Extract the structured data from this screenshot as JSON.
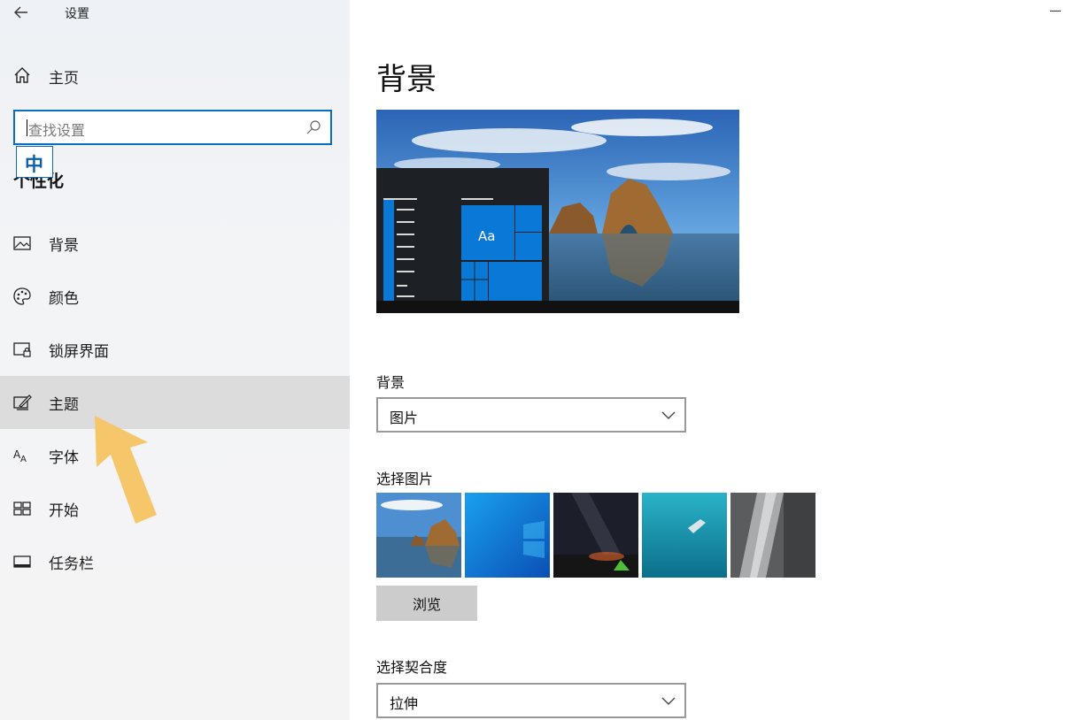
{
  "app": {
    "title": "设置"
  },
  "sidebar": {
    "home_label": "主页",
    "search": {
      "placeholder": "查找设置"
    },
    "ime_indicator": "中",
    "section_header": "个性化",
    "items": [
      {
        "label": "背景",
        "icon": "picture-icon"
      },
      {
        "label": "颜色",
        "icon": "palette-icon"
      },
      {
        "label": "锁屏界面",
        "icon": "lock-screen-icon"
      },
      {
        "label": "主题",
        "icon": "theme-brush-icon",
        "active": true
      },
      {
        "label": "字体",
        "icon": "font-icon"
      },
      {
        "label": "开始",
        "icon": "start-tiles-icon"
      },
      {
        "label": "任务栏",
        "icon": "taskbar-icon"
      }
    ]
  },
  "main": {
    "title": "背景",
    "preview": {
      "tile_text": "Aa"
    },
    "background": {
      "label": "背景",
      "value": "图片"
    },
    "choose_picture": {
      "label": "选择图片",
      "thumbnails": [
        "beach-rock",
        "windows-blue",
        "night-sky-tent",
        "underwater-swimmer",
        "rock-cliff"
      ]
    },
    "browse_label": "浏览",
    "fit": {
      "label": "选择契合度",
      "value": "拉伸"
    }
  },
  "colors": {
    "accent": "#0a6fc2",
    "tile_blue": "#0a78d7",
    "highlight_arrow": "#f6c66a"
  }
}
